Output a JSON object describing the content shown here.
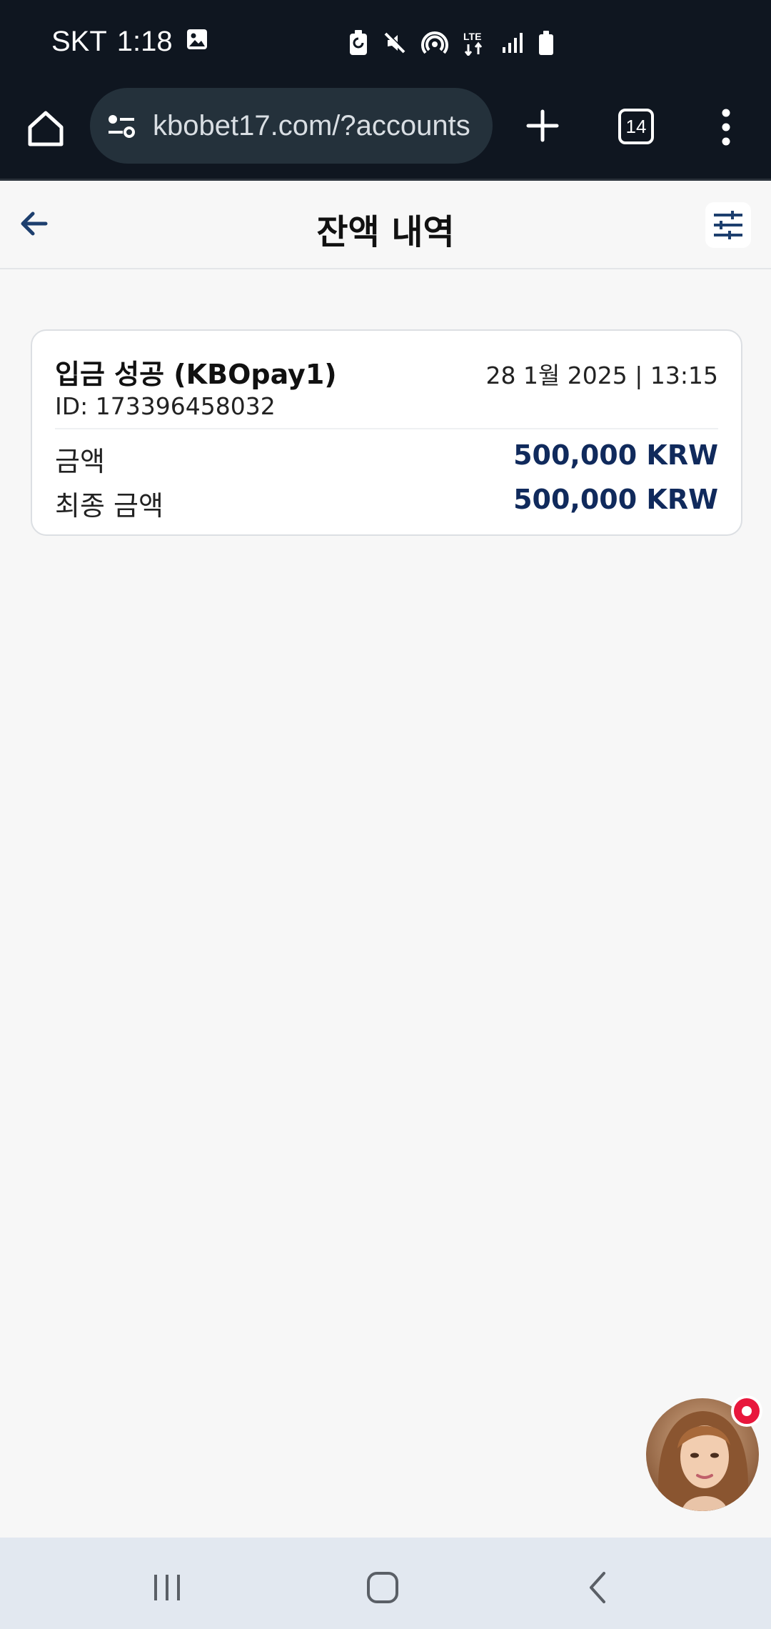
{
  "status_bar": {
    "carrier": "SKT",
    "time": "1:18",
    "icons": [
      "gallery-icon",
      "battery-saver-icon",
      "mute-icon",
      "hotspot-icon",
      "lte-icon",
      "signal-icon",
      "battery-icon"
    ],
    "network_label": "LTE"
  },
  "browser": {
    "url": "kbobet17.com/?accounts",
    "tab_count": "14"
  },
  "header": {
    "title": "잔액 내역"
  },
  "transactions": [
    {
      "title": "입금 성공 (KBOpay1)",
      "datetime": "28 1월 2025 | 13:15",
      "id": "ID: 173396458032",
      "amount_label": "금액",
      "amount_value": "500,000 KRW",
      "final_label": "최종 금액",
      "final_value": "500,000 KRW"
    }
  ],
  "colors": {
    "status_bg": "#0f1620",
    "amount_text": "#102a5c",
    "accent_blue": "#1d3f6e",
    "notification_red": "#e8173c",
    "nav_bg": "#e2e8f0"
  }
}
